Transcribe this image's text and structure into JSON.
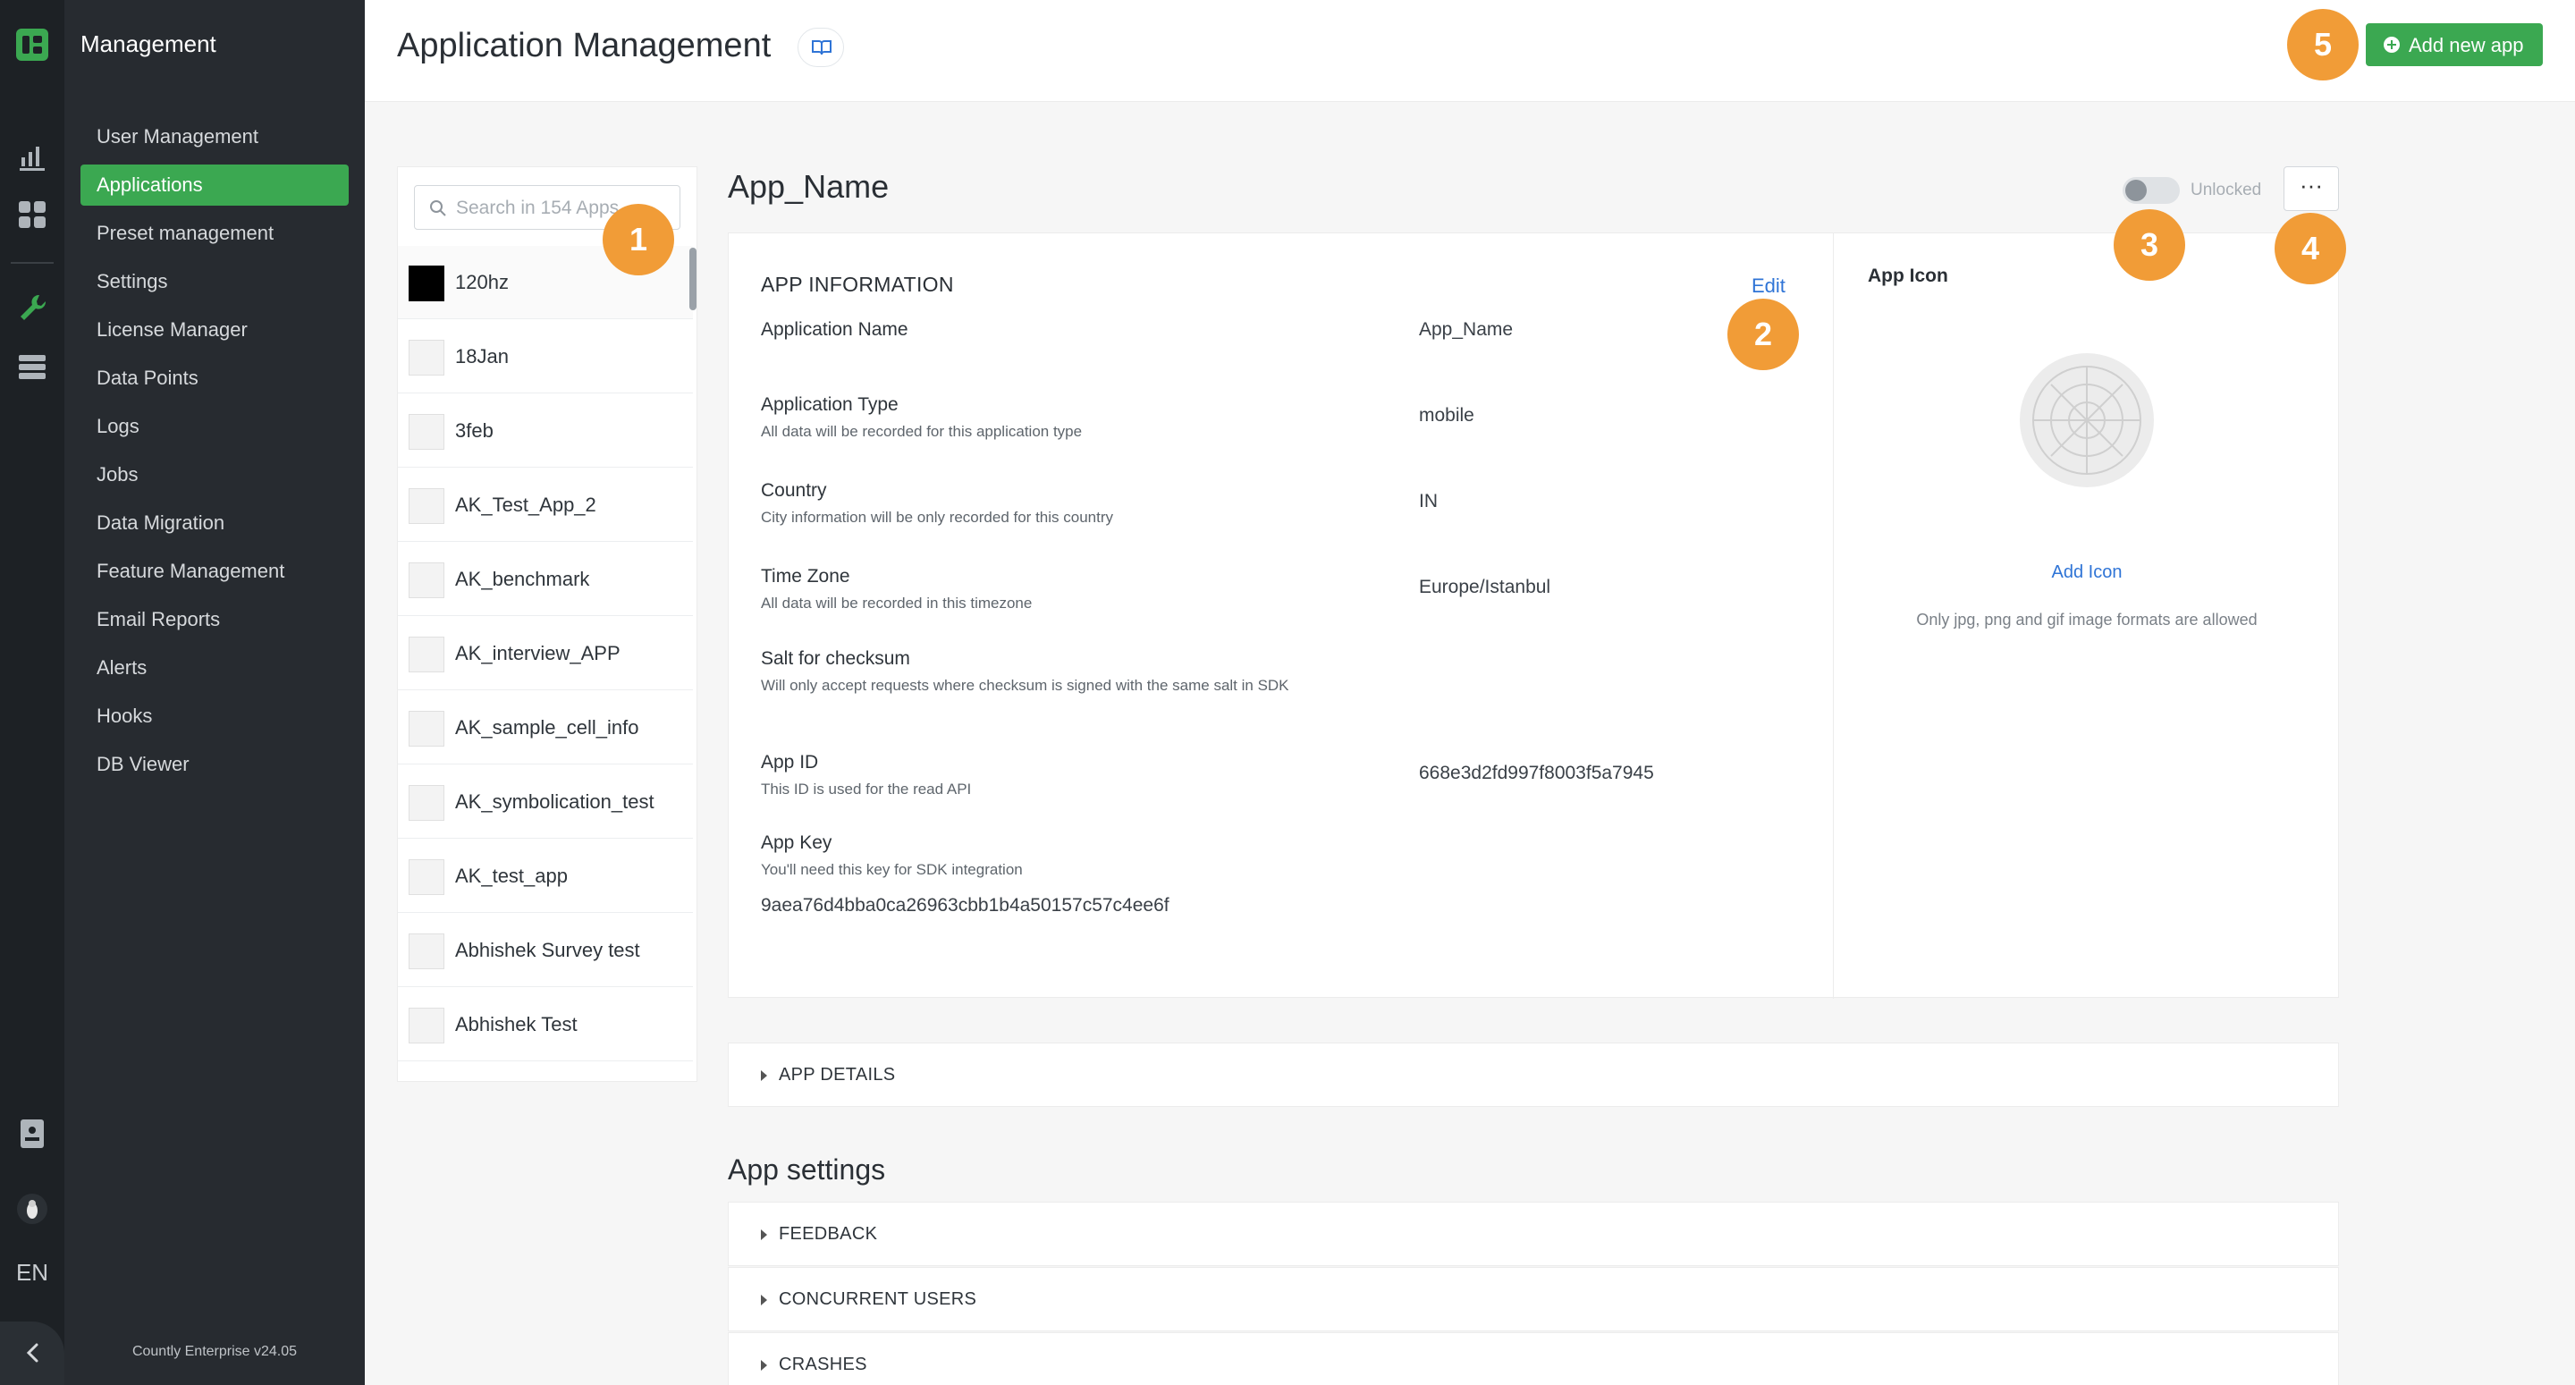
{
  "sidebar": {
    "title": "Management",
    "items": [
      {
        "label": "User Management",
        "active": false
      },
      {
        "label": "Applications",
        "active": true
      },
      {
        "label": "Preset management",
        "active": false
      },
      {
        "label": "Settings",
        "active": false
      },
      {
        "label": "License Manager",
        "active": false
      },
      {
        "label": "Data Points",
        "active": false
      },
      {
        "label": "Logs",
        "active": false
      },
      {
        "label": "Jobs",
        "active": false
      },
      {
        "label": "Data Migration",
        "active": false
      },
      {
        "label": "Feature Management",
        "active": false
      },
      {
        "label": "Email Reports",
        "active": false
      },
      {
        "label": "Alerts",
        "active": false
      },
      {
        "label": "Hooks",
        "active": false
      },
      {
        "label": "DB Viewer",
        "active": false
      }
    ],
    "version": "Countly Enterprise v24.05",
    "language": "EN"
  },
  "rail_icons": [
    "countly-logo-icon",
    "analytics-chart-icon",
    "dashboard-grid-icon",
    "management-wrench-icon",
    "database-icon",
    "help-book-icon",
    "user-avatar-icon",
    "collapse-chevron-icon"
  ],
  "header": {
    "title": "Application Management",
    "add_button": "Add new app"
  },
  "callouts": [
    "1",
    "2",
    "3",
    "4",
    "5"
  ],
  "app_list": {
    "search_placeholder": "Search in 154 Apps",
    "apps": [
      {
        "name": "120hz",
        "thumb": "black"
      },
      {
        "name": "18Jan",
        "thumb": "placeholder"
      },
      {
        "name": "3feb",
        "thumb": "placeholder"
      },
      {
        "name": "AK_Test_App_2",
        "thumb": "placeholder"
      },
      {
        "name": "AK_benchmark",
        "thumb": "placeholder"
      },
      {
        "name": "AK_interview_APP",
        "thumb": "placeholder"
      },
      {
        "name": "AK_sample_cell_info",
        "thumb": "placeholder"
      },
      {
        "name": "AK_symbolication_test",
        "thumb": "placeholder"
      },
      {
        "name": "AK_test_app",
        "thumb": "placeholder"
      },
      {
        "name": "Abhishek Survey test",
        "thumb": "placeholder"
      },
      {
        "name": "Abhishek Test",
        "thumb": "placeholder"
      }
    ]
  },
  "detail": {
    "app_name": "App_Name",
    "lock_status": "Unlocked",
    "more_label": "···",
    "info_title": "APP INFORMATION",
    "edit_label": "Edit",
    "fields": [
      {
        "label": "Application Name",
        "desc": "",
        "value": "App_Name"
      },
      {
        "label": "Application Type",
        "desc": "All data will be recorded for this application type",
        "value": "mobile"
      },
      {
        "label": "Country",
        "desc": "City information will be only recorded for this country",
        "value": "IN"
      },
      {
        "label": "Time Zone",
        "desc": "All data will be recorded in this timezone",
        "value": "Europe/Istanbul"
      },
      {
        "label": "Salt for checksum",
        "desc": "Will only accept requests where checksum is signed with the same salt in SDK",
        "value": ""
      },
      {
        "label": "App ID",
        "desc": "This ID is used for the read API",
        "value": "668e3d2fd997f8003f5a7945"
      },
      {
        "label": "App Key",
        "desc": "You'll need this key for SDK integration",
        "value": ""
      }
    ],
    "app_key_value": "9aea76d4bba0ca26963cbb1b4a50157c57c4ee6f",
    "icon_title": "App Icon",
    "add_icon": "Add Icon",
    "icon_note": "Only jpg, png and gif image formats are allowed"
  },
  "app_details_label": "APP DETAILS",
  "settings": {
    "title": "App settings",
    "sections": [
      "FEEDBACK",
      "CONCURRENT USERS",
      "CRASHES"
    ]
  },
  "colors": {
    "accent_green": "#3ba851",
    "callout_orange": "#f19c37",
    "link_blue": "#2f74d6",
    "rail_bg": "#1d2125",
    "sidebar_bg": "#272b30"
  }
}
